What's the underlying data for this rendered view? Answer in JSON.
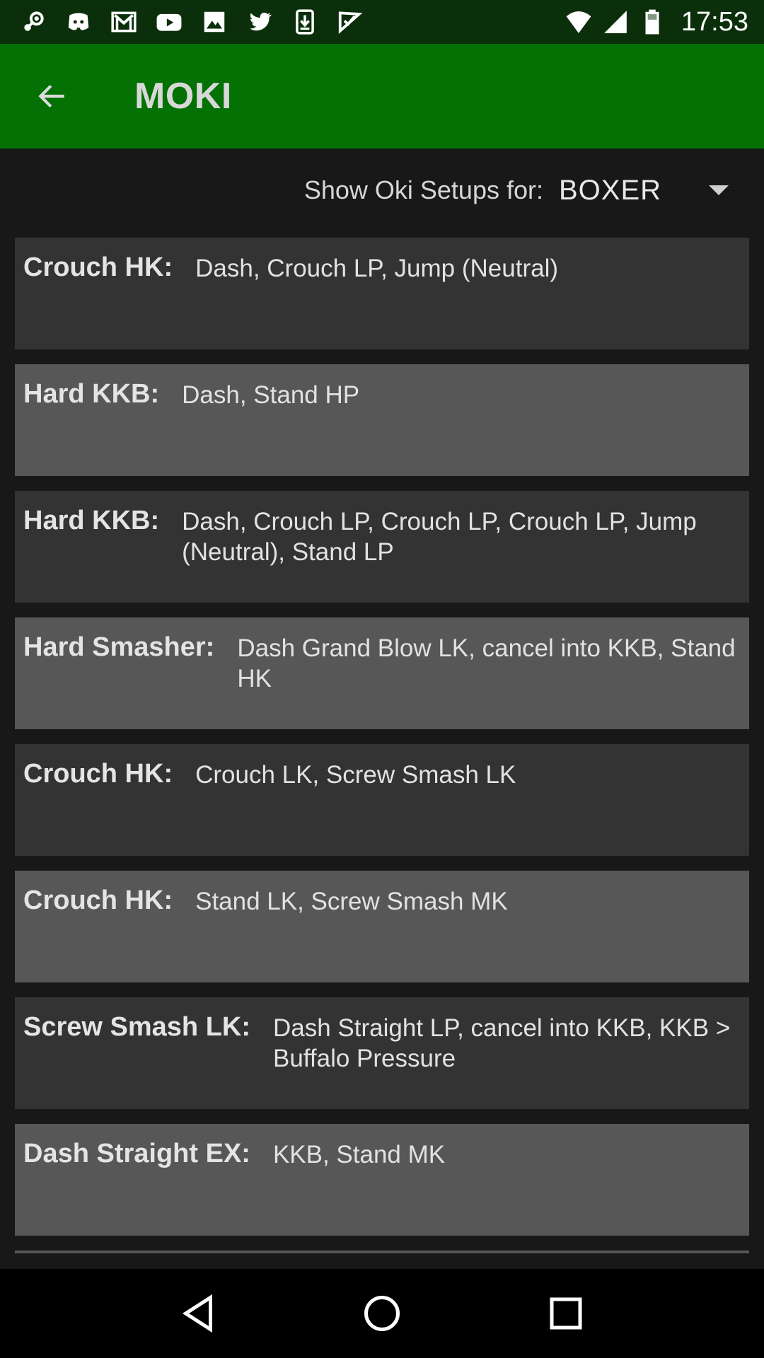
{
  "status_bar": {
    "time": "17:53",
    "left_icons": [
      "steam-icon",
      "discord-icon",
      "gmail-icon",
      "youtube-icon",
      "image-icon",
      "twitter-icon",
      "download-icon",
      "check-flag-icon"
    ],
    "right_icons": [
      "wifi-icon",
      "signal-icon",
      "battery-icon"
    ]
  },
  "app_bar": {
    "title": "MOKI",
    "background_color": "#037103"
  },
  "filter": {
    "label": "Show Oki Setups for:",
    "selected": "BOXER"
  },
  "setups": [
    {
      "key": "Crouch HK:",
      "value": "Dash, Crouch LP, Jump (Neutral)"
    },
    {
      "key": "Hard KKB:",
      "value": "Dash, Stand HP"
    },
    {
      "key": "Hard KKB:",
      "value": "Dash, Crouch LP, Crouch LP, Crouch LP, Jump (Neutral), Stand LP"
    },
    {
      "key": "Hard Smasher:",
      "value": "Dash Grand Blow LK, cancel into KKB, Stand HK"
    },
    {
      "key": "Crouch HK:",
      "value": "Crouch LK, Screw Smash LK"
    },
    {
      "key": "Crouch HK:",
      "value": "Stand LK, Screw Smash MK"
    },
    {
      "key": "Screw Smash LK:",
      "value": "Dash Straight LP, cancel into KKB, KKB > Buffalo Pressure"
    },
    {
      "key": "Dash Straight EX:",
      "value": "KKB, Stand MK"
    }
  ],
  "nav_bar": {
    "buttons": [
      "back-triangle-icon",
      "home-circle-icon",
      "recents-square-icon"
    ]
  }
}
